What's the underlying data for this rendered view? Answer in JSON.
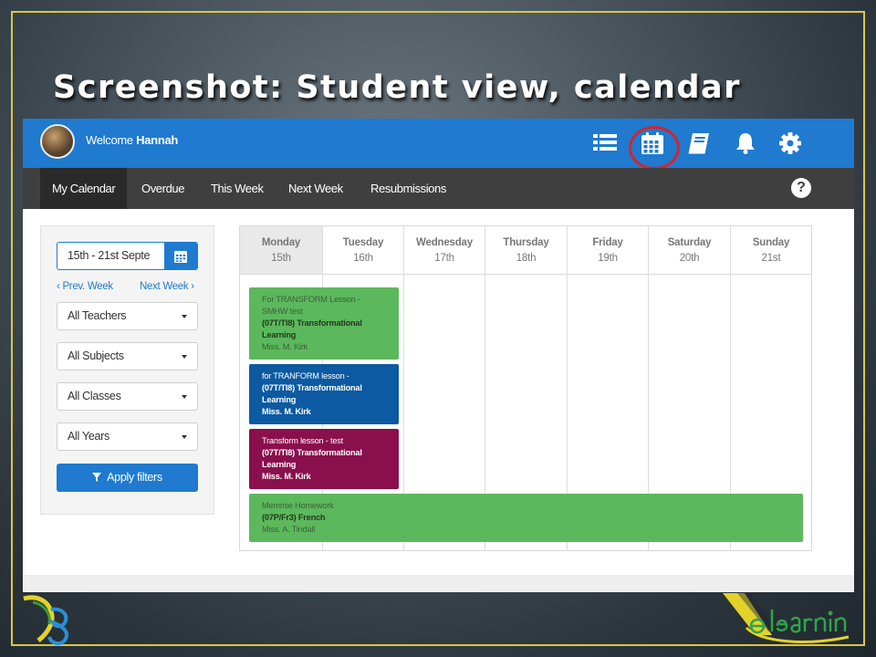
{
  "slide": {
    "title": "Screenshot: Student view, calendar",
    "accent_color": "#d8c64a"
  },
  "topbar": {
    "welcome_prefix": "Welcome ",
    "user_name": "Hannah",
    "bg_color": "#1f7ad0",
    "icons": [
      "list-icon",
      "calendar-icon",
      "book-icon",
      "bell-icon",
      "gear-icon"
    ],
    "highlighted_icon": "calendar-icon",
    "highlight_color": "#d6242b"
  },
  "subnav": {
    "items": [
      {
        "label": "My Calendar",
        "active": true
      },
      {
        "label": "Overdue",
        "active": false
      },
      {
        "label": "This Week",
        "active": false
      },
      {
        "label": "Next Week",
        "active": false
      },
      {
        "label": "Resubmissions",
        "active": false
      }
    ],
    "help_icon": "?"
  },
  "filters": {
    "date_range_value": "15th - 21st Septe",
    "prev_week_label": "Prev. Week",
    "next_week_label": "Next Week",
    "teachers": "All Teachers",
    "subjects": "All Subjects",
    "classes": "All Classes",
    "years": "All Years",
    "apply_label": "Apply filters"
  },
  "calendar": {
    "days": [
      {
        "name": "Monday",
        "date": "15th",
        "today": true
      },
      {
        "name": "Tuesday",
        "date": "16th",
        "today": false
      },
      {
        "name": "Wednesday",
        "date": "17th",
        "today": false
      },
      {
        "name": "Thursday",
        "date": "18th",
        "today": false
      },
      {
        "name": "Friday",
        "date": "19th",
        "today": false
      },
      {
        "name": "Saturday",
        "date": "20th",
        "today": false
      },
      {
        "name": "Sunday",
        "date": "21st",
        "today": false
      }
    ],
    "events": [
      {
        "title": "For TRANSFORM Lesson - SMHW test",
        "class": "(07T/TI8) Transformational Learning",
        "teacher": "Miss. M. Kirk",
        "color": "#5cb85c"
      },
      {
        "title": "for TRANFORM lesson -",
        "class": "(07T/TI8) Transformational Learning",
        "teacher": "Miss. M. Kirk",
        "color": "#0c5aa2"
      },
      {
        "title": "Transform lesson - test",
        "class": "(07T/TI8) Transformational Learning",
        "teacher": "Miss. M. Kirk",
        "color": "#8a0f4d"
      },
      {
        "title": "Memrise Homework",
        "class": "(07P/Fr3) French",
        "teacher": "Miss. A. Tindall",
        "color": "#5cb85c"
      }
    ]
  }
}
